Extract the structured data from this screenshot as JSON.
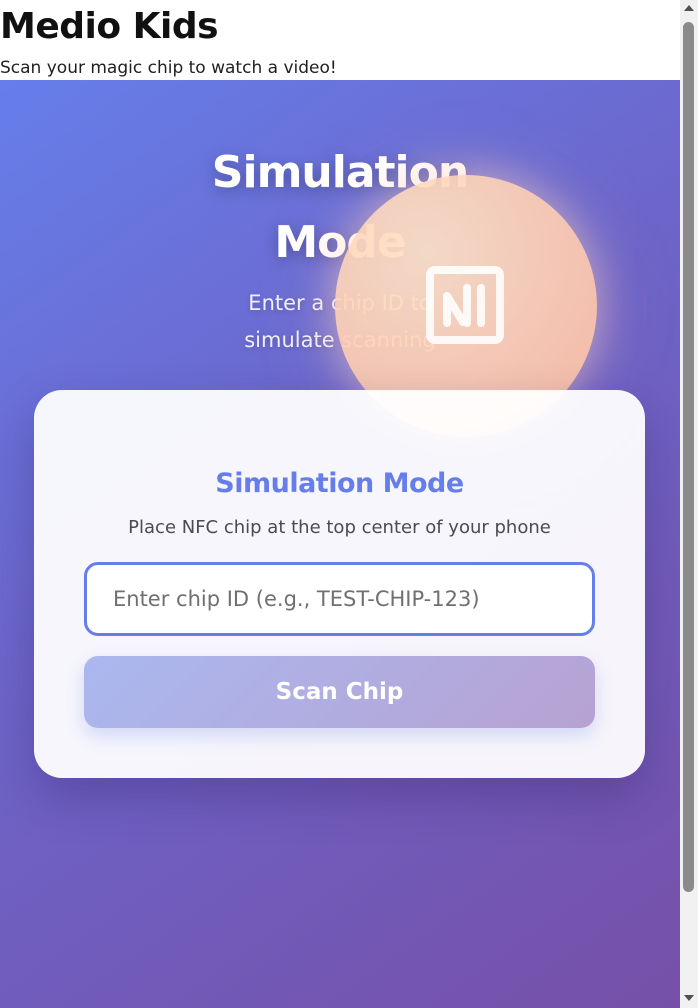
{
  "header": {
    "title": "Medio Kids",
    "subtitle": "Scan your magic chip to watch a video!"
  },
  "hero": {
    "title": "Simulation Mode",
    "subtitle": "Enter a chip ID to simulate scanning",
    "icon": "nfc-icon"
  },
  "card": {
    "title": "Simulation Mode",
    "instruction": "Place NFC chip at the top center of your phone",
    "input": {
      "value": "",
      "placeholder": "Enter chip ID (e.g., TEST-CHIP-123)"
    },
    "button_label": "Scan Chip"
  },
  "colors": {
    "background_start": "#667eea",
    "background_end": "#764ba2",
    "accent": "#667eea",
    "orb": "#ffd3b6"
  }
}
